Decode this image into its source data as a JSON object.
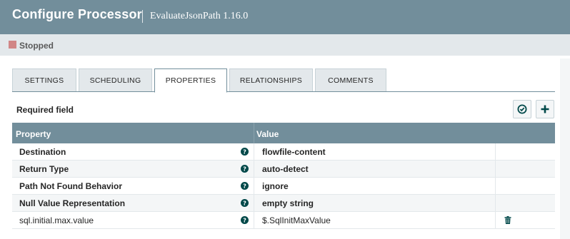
{
  "header": {
    "title": "Configure Processor",
    "subtitle": "EvaluateJsonPath 1.16.0"
  },
  "status": {
    "label": "Stopped",
    "color": "#d18686"
  },
  "tabs": [
    {
      "label": "SETTINGS",
      "active": false
    },
    {
      "label": "SCHEDULING",
      "active": false
    },
    {
      "label": "PROPERTIES",
      "active": true
    },
    {
      "label": "RELATIONSHIPS",
      "active": false
    },
    {
      "label": "COMMENTS",
      "active": false
    }
  ],
  "properties_panel": {
    "required_label": "Required field",
    "verify_icon": "check-circle-icon",
    "add_icon": "plus-icon",
    "columns": {
      "property": "Property",
      "value": "Value"
    },
    "rows": [
      {
        "property": "Destination",
        "value": "flowfile-content",
        "required": true,
        "deletable": false
      },
      {
        "property": "Return Type",
        "value": "auto-detect",
        "required": true,
        "deletable": false
      },
      {
        "property": "Path Not Found Behavior",
        "value": "ignore",
        "required": true,
        "deletable": false
      },
      {
        "property": "Null Value Representation",
        "value": "empty string",
        "required": true,
        "deletable": false
      },
      {
        "property": "sql.initial.max.value",
        "value": "$.SqlInitMaxValue",
        "required": false,
        "deletable": true
      }
    ]
  },
  "colors": {
    "header": "#728e9b",
    "status_bar": "#e3e8eb",
    "accent_icon": "#004849"
  }
}
